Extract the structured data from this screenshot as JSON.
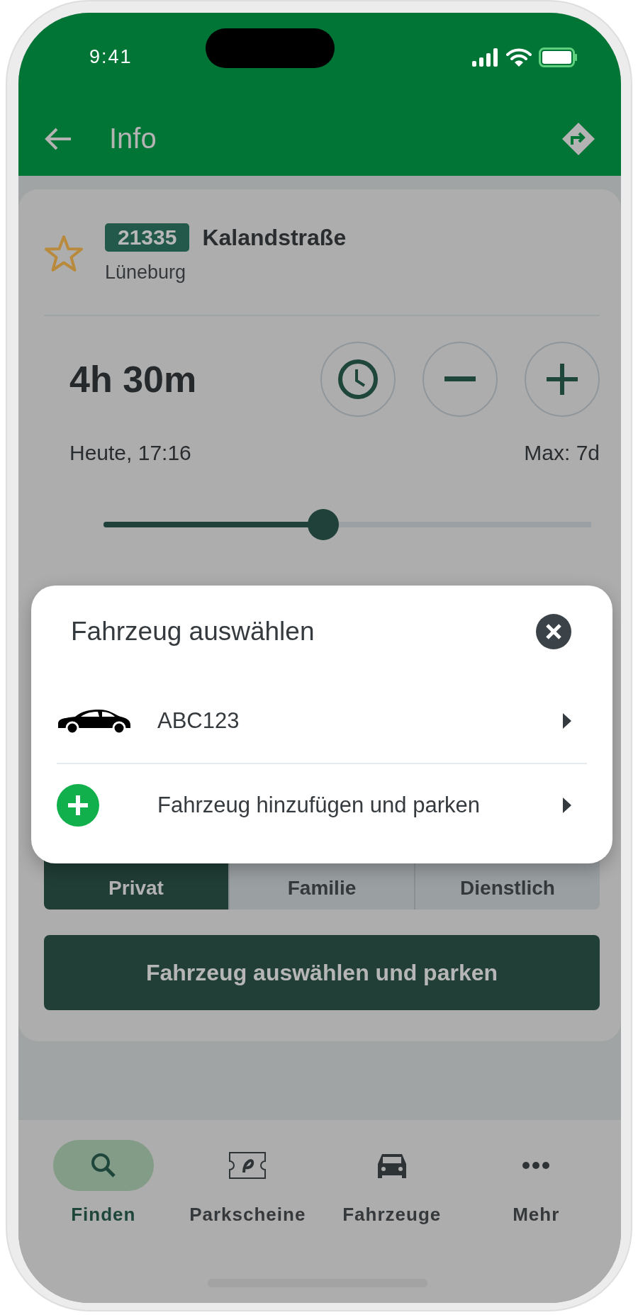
{
  "status_bar": {
    "time": "9:41"
  },
  "header": {
    "title": "Info"
  },
  "zone": {
    "code": "21335",
    "street": "Kalandstraße",
    "city": "Lüneburg",
    "favorite": false
  },
  "duration": {
    "value": "4h 30m",
    "end_time": "Heute, 17:16",
    "max": "Max: 7d",
    "level": 0.45
  },
  "usage_tabs": [
    {
      "label": "Privat",
      "selected": true
    },
    {
      "label": "Familie",
      "selected": false
    },
    {
      "label": "Dienstlich",
      "selected": false
    }
  ],
  "primary_button": "Fahrzeug auswählen und parken",
  "dialog": {
    "title": "Fahrzeug auswählen",
    "items": [
      {
        "kind": "vehicle",
        "label": "ABC123"
      },
      {
        "kind": "add",
        "label": "Fahrzeug hinzufügen und parken"
      }
    ]
  },
  "bottom_nav": [
    {
      "label": "Finden",
      "selected": true
    },
    {
      "label": "Parkscheine",
      "selected": false
    },
    {
      "label": "Fahrzeuge",
      "selected": false
    },
    {
      "label": "Mehr",
      "selected": false
    }
  ]
}
